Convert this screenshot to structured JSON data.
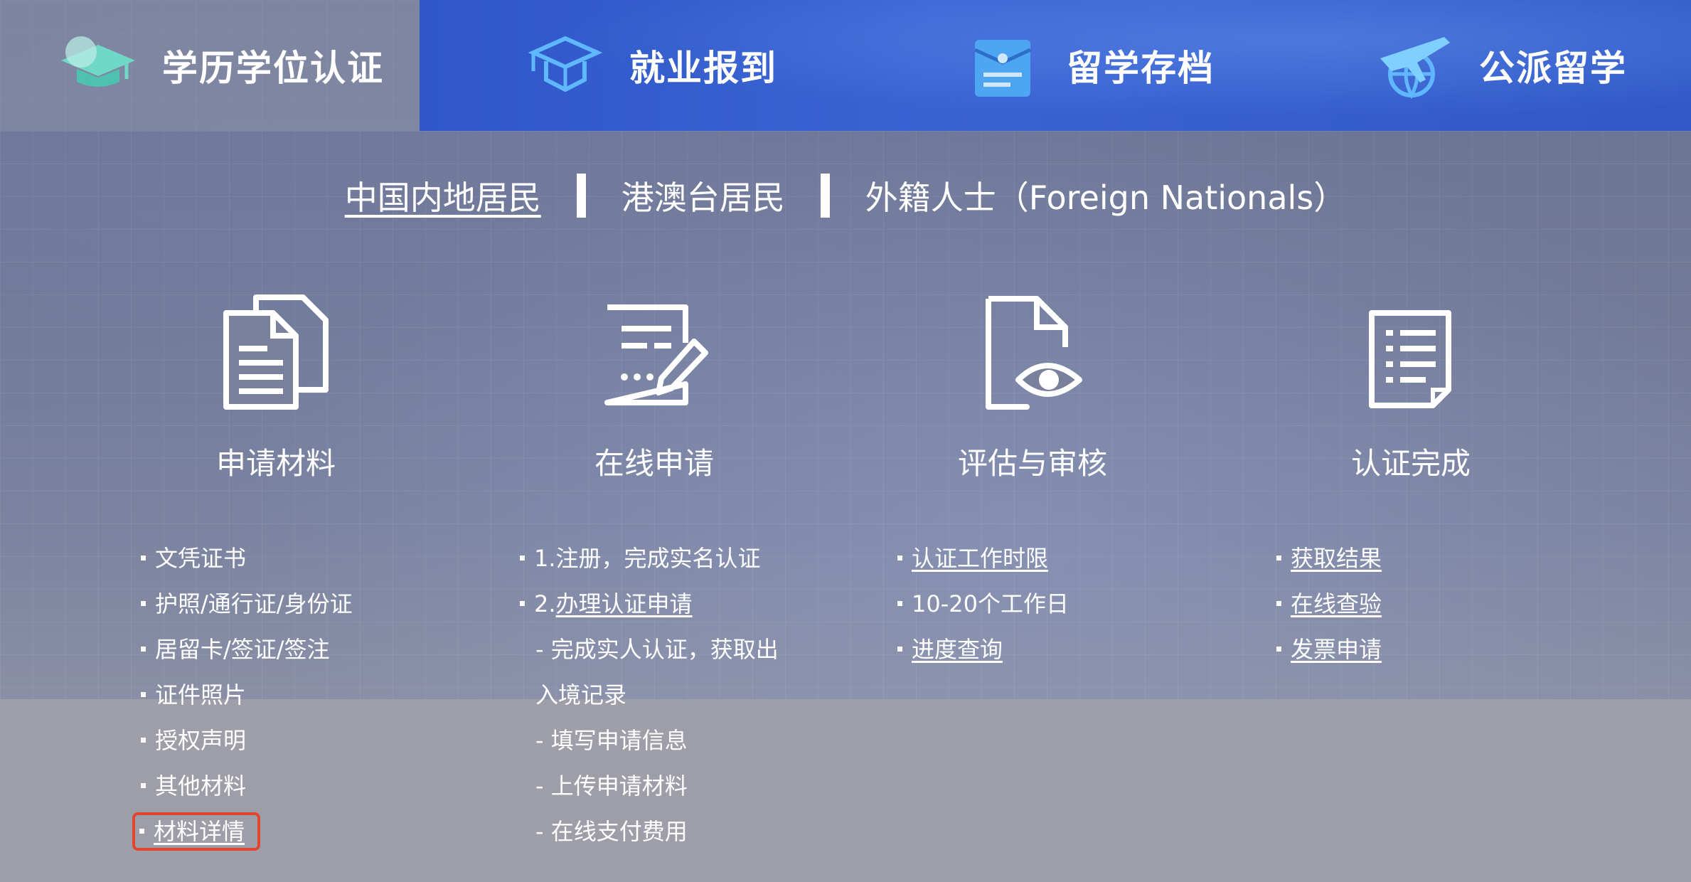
{
  "top_tabs": [
    {
      "label": "学历学位认证",
      "icon": "graduation-cap-icon",
      "active": true
    },
    {
      "label": "就业报到",
      "icon": "mortarboard-book-icon",
      "active": false
    },
    {
      "label": "留学存档",
      "icon": "archive-folder-icon",
      "active": false
    },
    {
      "label": "公派留学",
      "icon": "airplane-globe-icon",
      "active": false
    }
  ],
  "categories": [
    {
      "label": "中国内地居民",
      "active": true
    },
    {
      "label": "港澳台居民",
      "active": false
    },
    {
      "label": "外籍人士（Foreign Nationals）",
      "active": false
    }
  ],
  "steps": [
    {
      "title": "申请材料",
      "icon": "documents-icon"
    },
    {
      "title": "在线申请",
      "icon": "form-edit-icon"
    },
    {
      "title": "评估与审核",
      "icon": "document-eye-icon"
    },
    {
      "title": "认证完成",
      "icon": "checklist-icon"
    }
  ],
  "materials": {
    "items": [
      "文凭证书",
      "护照/通行证/身份证",
      "居留卡/签证/签注",
      "证件照片",
      "授权声明",
      "其他材料"
    ],
    "details_link": "材料详情"
  },
  "online": {
    "step1": "1.注册，完成实名认证",
    "step2_prefix": "2.",
    "step2_link": "办理认证申请",
    "sub": [
      "- 完成实人认证，获取出",
      "入境记录",
      "- 填写申请信息",
      "- 上传申请材料",
      "- 在线支付费用"
    ]
  },
  "review": {
    "time_limit_link": "认证工作时限",
    "duration": "10-20个工作日",
    "progress_link": "进度查询"
  },
  "complete": {
    "links": [
      "获取结果",
      "在线查验",
      "发票申请"
    ]
  },
  "colors": {
    "tab_strip": "#3058c6",
    "highlight_border": "#e2452f",
    "background": "#6d7593"
  }
}
